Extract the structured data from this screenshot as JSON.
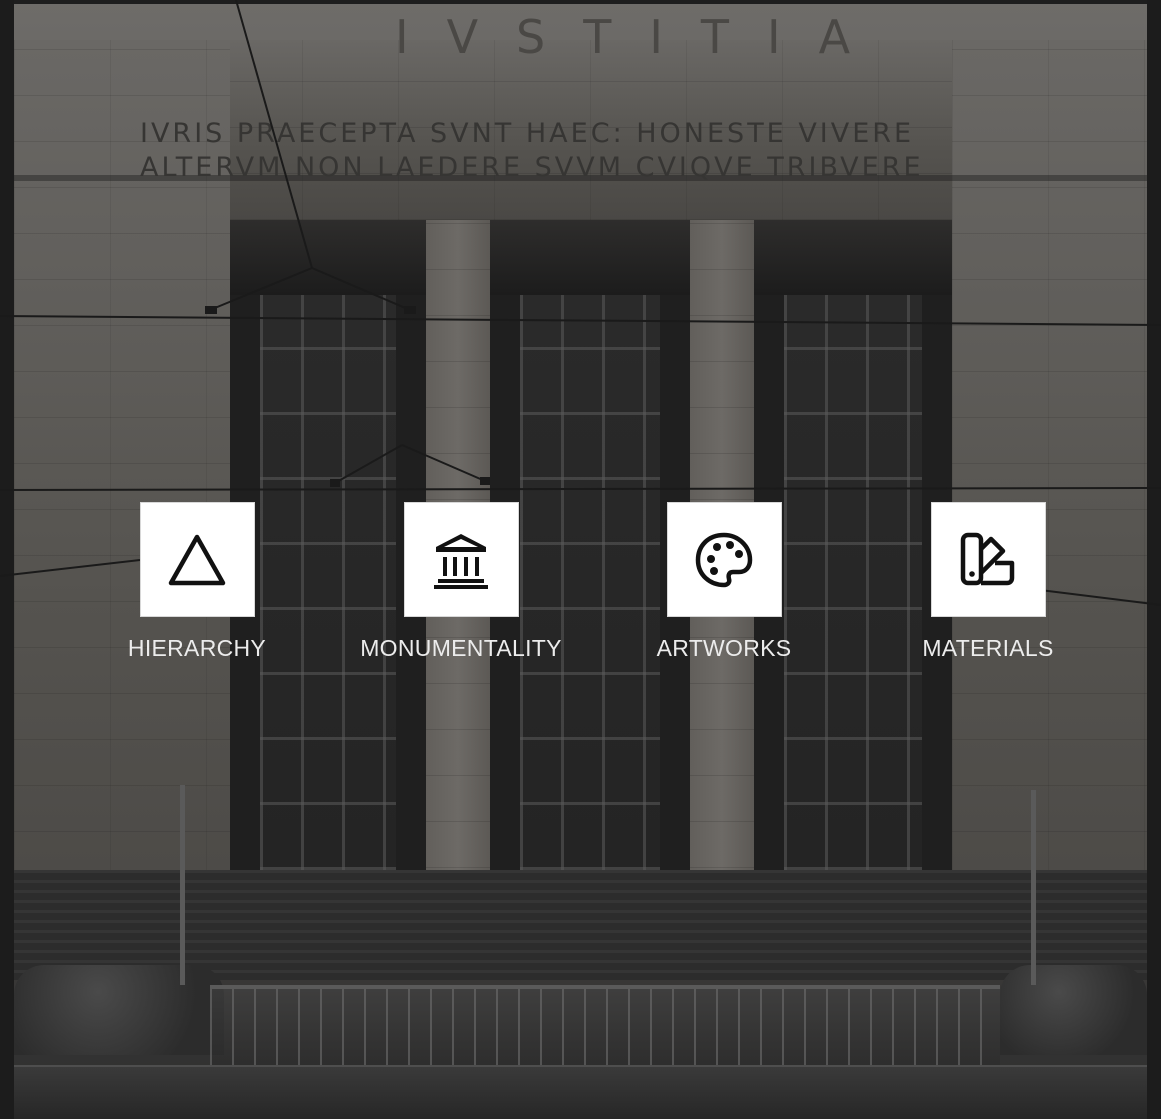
{
  "inscription": {
    "title": "IVSTITIA",
    "line1": "IVRIS PRAECEPTA SVNT HAEC: HONESTE VIVERE",
    "line2": "ALTERVM NON LAEDERE SVVM CVIQVE TRIBVERE"
  },
  "features": [
    {
      "label": "HIERARCHY",
      "icon": "triangle-icon"
    },
    {
      "label": "MONUMENTALITY",
      "icon": "classical-building-icon"
    },
    {
      "label": "ARTWORKS",
      "icon": "palette-icon"
    },
    {
      "label": "MATERIALS",
      "icon": "swatchbook-icon"
    }
  ],
  "colors": {
    "tile_background": "#ffffff",
    "icon": "#111111",
    "label_text": "#ececec",
    "background_overlay": "#3a3938"
  }
}
